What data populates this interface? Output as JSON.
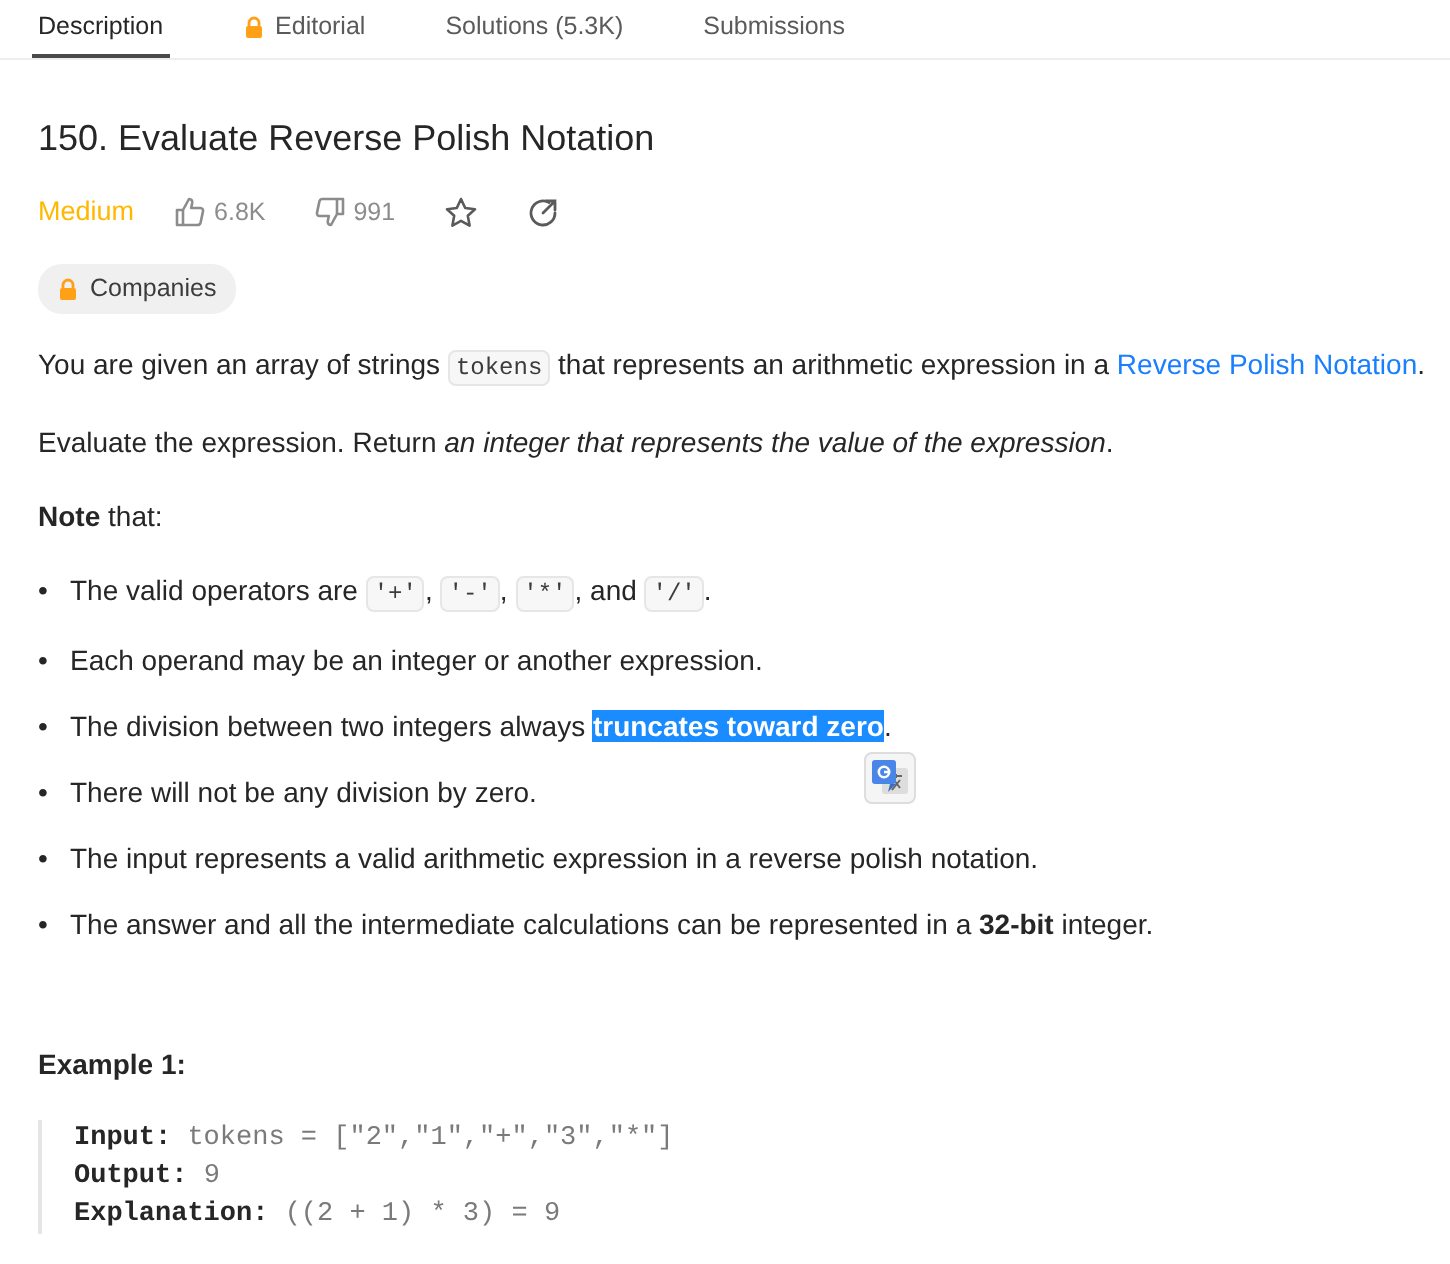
{
  "tabs": [
    {
      "label": "Description",
      "selected": true,
      "locked": false
    },
    {
      "label": "Editorial",
      "selected": false,
      "locked": true
    },
    {
      "label": "Solutions (5.3K)",
      "selected": false,
      "locked": false
    },
    {
      "label": "Submissions",
      "selected": false,
      "locked": false
    }
  ],
  "problem": {
    "title": "150. Evaluate Reverse Polish Notation",
    "difficulty": "Medium",
    "likes": "6.8K",
    "dislikes": "991",
    "starred": false
  },
  "companies_chip": {
    "label": "Companies",
    "locked": true
  },
  "paragraphs": [
    {
      "segments": [
        {
          "kind": "text",
          "text": "You are given an array of strings "
        },
        {
          "kind": "code",
          "text": "tokens"
        },
        {
          "kind": "text",
          "text": " that represents an arithmetic expression in a "
        },
        {
          "kind": "link",
          "text": "Reverse Polish Notation"
        },
        {
          "kind": "text",
          "text": "."
        }
      ]
    },
    {
      "segments": [
        {
          "kind": "text",
          "text": "Evaluate the expression. Return "
        },
        {
          "kind": "italic",
          "text": "an integer that represents the value of the expression"
        },
        {
          "kind": "text",
          "text": "."
        }
      ]
    },
    {
      "segments": [
        {
          "kind": "bold",
          "text": "Note"
        },
        {
          "kind": "text",
          "text": " that:"
        }
      ]
    }
  ],
  "bullets": [
    {
      "marker": "•",
      "segments": [
        {
          "kind": "text",
          "text": "The valid operators are "
        },
        {
          "kind": "code",
          "text": "'+'"
        },
        {
          "kind": "text",
          "text": ", "
        },
        {
          "kind": "code",
          "text": "'-'"
        },
        {
          "kind": "text",
          "text": ", "
        },
        {
          "kind": "code",
          "text": "'*'"
        },
        {
          "kind": "text",
          "text": ", and "
        },
        {
          "kind": "code",
          "text": "'/'"
        },
        {
          "kind": "text",
          "text": "."
        }
      ]
    },
    {
      "marker": "•",
      "segments": [
        {
          "kind": "text",
          "text": "Each operand may be an integer or another expression."
        }
      ]
    },
    {
      "marker": "•",
      "segments": [
        {
          "kind": "text",
          "text": "The division between two integers always "
        },
        {
          "kind": "selection",
          "text": "truncates toward zero"
        },
        {
          "kind": "text",
          "text": "."
        }
      ]
    },
    {
      "marker": "•",
      "segments": [
        {
          "kind": "text",
          "text": "There will not be any division by zero."
        }
      ]
    },
    {
      "marker": "•",
      "segments": [
        {
          "kind": "text",
          "text": "The input represents a valid arithmetic expression in a reverse polish notation."
        }
      ]
    },
    {
      "marker": "•",
      "segments": [
        {
          "kind": "text",
          "text": "The answer and all the intermediate calculations can be represented in a "
        },
        {
          "kind": "bold",
          "text": "32-bit"
        },
        {
          "kind": "text",
          "text": " integer."
        }
      ]
    }
  ],
  "examples": [
    {
      "title": "Example 1:",
      "lines": [
        {
          "label": "Input:",
          "value": "tokens = [\"2\",\"1\",\"+\",\"3\",\"*\"]"
        },
        {
          "label": "Output:",
          "value": "9"
        },
        {
          "label": "Explanation:",
          "value": "((2 + 1) * 3) = 9"
        }
      ]
    }
  ]
}
